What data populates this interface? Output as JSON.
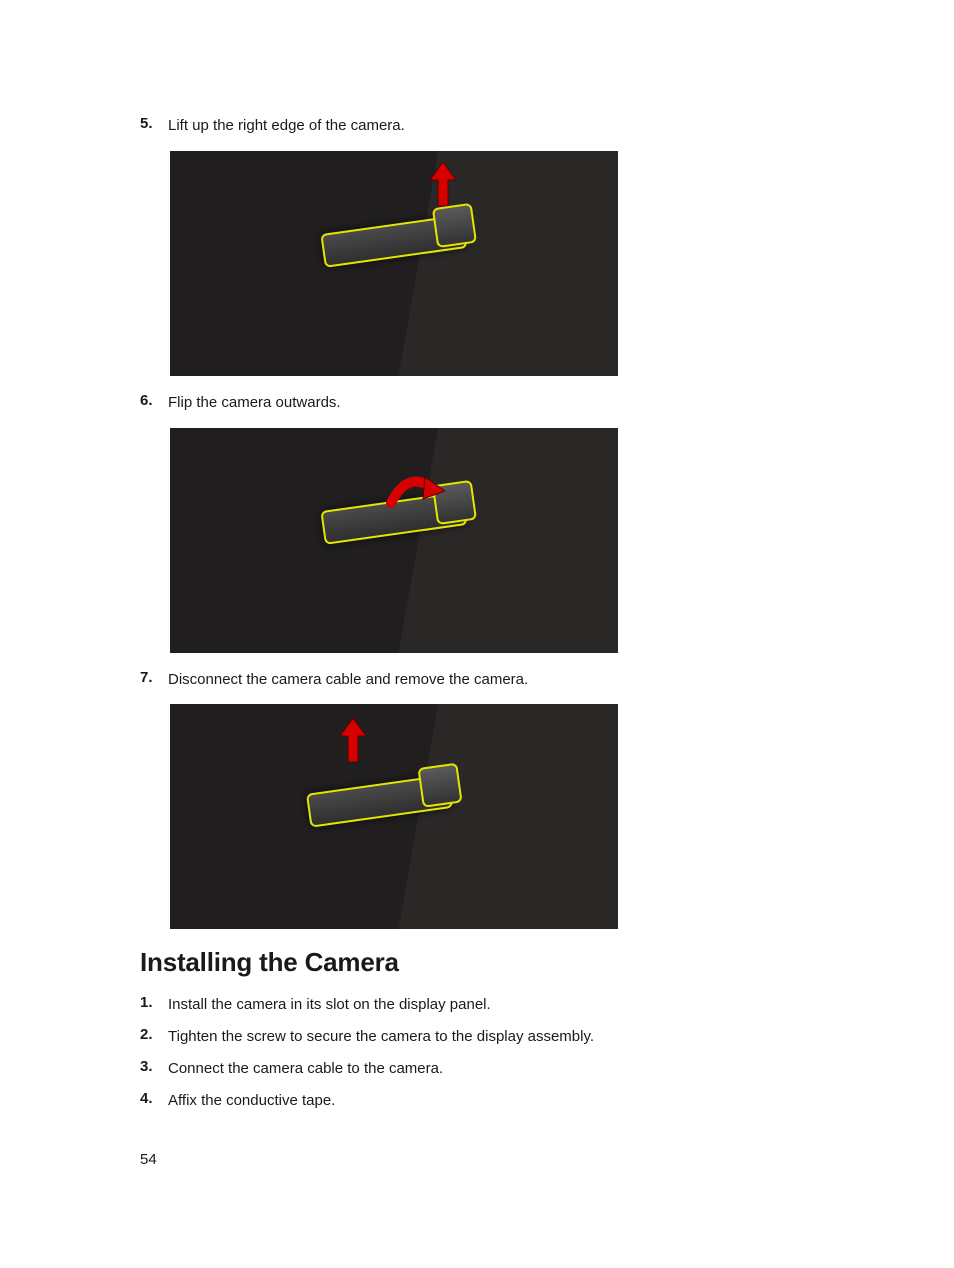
{
  "removal_steps": [
    {
      "num": "5.",
      "text": "Lift up the right edge of the camera."
    },
    {
      "num": "6.",
      "text": "Flip the camera outwards."
    },
    {
      "num": "7.",
      "text": "Disconnect the camera cable and remove the camera."
    }
  ],
  "section_heading": "Installing the Camera",
  "install_steps": [
    {
      "num": "1.",
      "text": "Install the camera in its slot on the display panel."
    },
    {
      "num": "2.",
      "text": "Tighten the screw to secure the camera to the display assembly."
    },
    {
      "num": "3.",
      "text": "Connect the camera cable to the camera."
    },
    {
      "num": "4.",
      "text": "Affix the conductive tape."
    }
  ],
  "page_number": "54"
}
